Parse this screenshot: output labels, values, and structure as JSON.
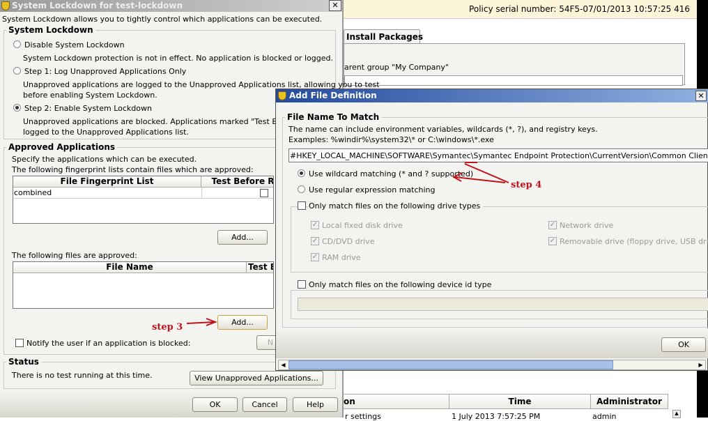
{
  "background": {
    "policy_serial": "Policy serial number: 54F5-07/01/2013 10:57:25 416",
    "tab_install_packages": "Install Packages",
    "inherit_text": "arent group \"My Company\"",
    "log_table": {
      "headers": [
        "on",
        "Time",
        "Administrator"
      ],
      "rows": [
        [
          "r settings",
          "1 July 2013 7:57:25 PM",
          "admin"
        ]
      ]
    }
  },
  "lockdown_dialog": {
    "title": "System Lockdown for test-lockdown",
    "intro": "System Lockdown allows you to tightly control which applications can be executed.",
    "section_lockdown": "System Lockdown",
    "options": [
      {
        "label": "Disable System Lockdown",
        "desc": "System Lockdown protection is not in effect. No application is blocked or logged.",
        "selected": false
      },
      {
        "label": "Step 1: Log Unapproved Applications Only",
        "desc": "Unapproved applications are logged to the Unapproved Applications list, allowing you to test",
        "desc2": "before enabling System Lockdown.",
        "selected": false
      },
      {
        "label": "Step 2: Enable System Lockdown",
        "desc": "Unapproved applications are blocked. Applications marked \"Test Before Re",
        "desc2": "logged to the Unapproved Applications list.",
        "selected": true
      }
    ],
    "section_approved": "Approved Applications",
    "approved_desc1": "Specify the applications which can be executed.",
    "approved_desc2": "The following fingerprint lists contain files which are approved:",
    "fingerprint_headers": [
      "File Fingerprint List",
      "Test Before R"
    ],
    "fingerprint_rows": [
      {
        "name": "combined",
        "test": false
      }
    ],
    "add_label": "Add...",
    "files_label": "The following files are approved:",
    "file_headers": [
      "File Name",
      "Test B"
    ],
    "notify_label": "Notify the user if an application is blocked:",
    "notify_checked": false,
    "notify_button": "N",
    "section_status": "Status",
    "status_text": "There is no test running at this time.",
    "view_unapproved": "View Unapproved Applications...",
    "ok": "OK",
    "cancel": "Cancel",
    "help": "Help"
  },
  "annotations": {
    "step3": "step 3",
    "step4": "step 4"
  },
  "file_def_dialog": {
    "title": "Add File Definition",
    "section": "File Name To Match",
    "desc1": "The name can include environment variables, wildcards (*, ?), and registry keys.",
    "desc2": "Examples: %windir%\\system32\\* or C:\\windows\\*.exe",
    "path_value": "#HKEY_LOCAL_MACHINE\\SOFTWARE\\Symantec\\Symantec Endpoint Protection\\CurrentVersion\\Common Client\\PathExpansi",
    "wildcard_label": "Use wildcard matching (* and ? supported)",
    "regex_label": "Use regular expression matching",
    "drive_types_label": "Only match files on the following drive types",
    "drives": [
      {
        "label": "Local fixed disk drive",
        "checked": true
      },
      {
        "label": "CD/DVD drive",
        "checked": true
      },
      {
        "label": "RAM drive",
        "checked": true
      },
      {
        "label": "Network drive",
        "checked": true
      },
      {
        "label": "Removable drive (floppy drive, USB drive, e",
        "checked": true
      }
    ],
    "device_id_label": "Only match files on the following device id type",
    "ok": "OK"
  }
}
